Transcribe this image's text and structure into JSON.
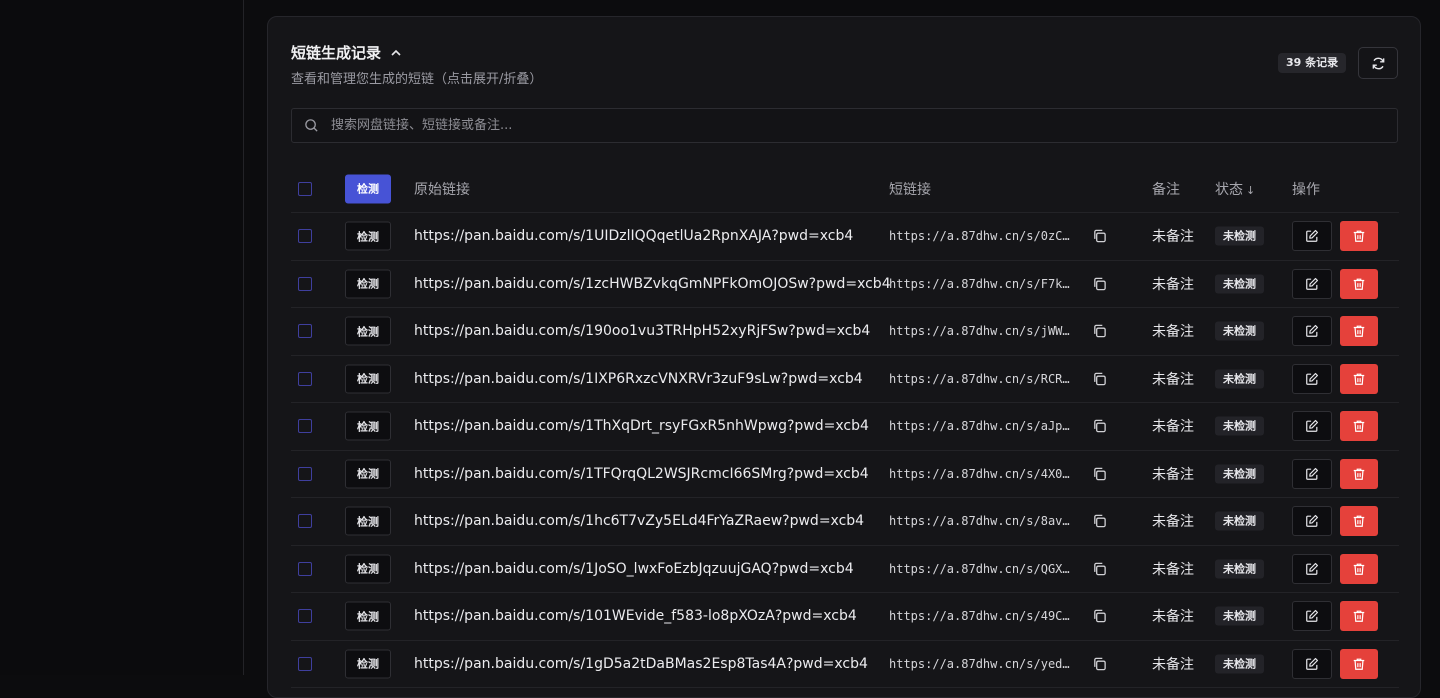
{
  "panel": {
    "title": "短链生成记录",
    "subtitle": "查看和管理您生成的短链（点击展开/折叠）",
    "count_badge": "39 条记录"
  },
  "search": {
    "placeholder": "搜索网盘链接、短链接或备注..."
  },
  "table": {
    "headers": {
      "detect": "检测",
      "original": "原始链接",
      "short": "短链接",
      "note": "备注",
      "status": "状态",
      "status_sort": "↓",
      "actions": "操作"
    },
    "rows": [
      {
        "detect": "检测",
        "original": "https://pan.baidu.com/s/1UIDzlIQQqetlUa2RpnXAJA?pwd=xcb4",
        "short": "https://a.87dhw.cn/s/0zC…",
        "note": "未备注",
        "status": "未检测"
      },
      {
        "detect": "检测",
        "original": "https://pan.baidu.com/s/1zcHWBZvkqGmNPFkOmOJOSw?pwd=xcb4",
        "short": "https://a.87dhw.cn/s/F7k…",
        "note": "未备注",
        "status": "未检测"
      },
      {
        "detect": "检测",
        "original": "https://pan.baidu.com/s/190oo1vu3TRHpH52xyRjFSw?pwd=xcb4",
        "short": "https://a.87dhw.cn/s/jWW…",
        "note": "未备注",
        "status": "未检测"
      },
      {
        "detect": "检测",
        "original": "https://pan.baidu.com/s/1IXP6RxzcVNXRVr3zuF9sLw?pwd=xcb4",
        "short": "https://a.87dhw.cn/s/RCR…",
        "note": "未备注",
        "status": "未检测"
      },
      {
        "detect": "检测",
        "original": "https://pan.baidu.com/s/1ThXqDrt_rsyFGxR5nhWpwg?pwd=xcb4",
        "short": "https://a.87dhw.cn/s/aJp…",
        "note": "未备注",
        "status": "未检测"
      },
      {
        "detect": "检测",
        "original": "https://pan.baidu.com/s/1TFQrqQL2WSJRcmcI66SMrg?pwd=xcb4",
        "short": "https://a.87dhw.cn/s/4X0…",
        "note": "未备注",
        "status": "未检测"
      },
      {
        "detect": "检测",
        "original": "https://pan.baidu.com/s/1hc6T7vZy5ELd4FrYaZRaew?pwd=xcb4",
        "short": "https://a.87dhw.cn/s/8av…",
        "note": "未备注",
        "status": "未检测"
      },
      {
        "detect": "检测",
        "original": "https://pan.baidu.com/s/1JoSO_lwxFoEzbJqzuujGAQ?pwd=xcb4",
        "short": "https://a.87dhw.cn/s/QGX…",
        "note": "未备注",
        "status": "未检测"
      },
      {
        "detect": "检测",
        "original": "https://pan.baidu.com/s/101WEvide_f583-lo8pXOzA?pwd=xcb4",
        "short": "https://a.87dhw.cn/s/49C…",
        "note": "未备注",
        "status": "未检测"
      },
      {
        "detect": "检测",
        "original": "https://pan.baidu.com/s/1gD5a2tDaBMas2Esp8Tas4A?pwd=xcb4",
        "short": "https://a.87dhw.cn/s/yed…",
        "note": "未备注",
        "status": "未检测"
      }
    ]
  },
  "icons": {
    "chevron": "chevron-up-icon",
    "refresh": "refresh-icon",
    "search": "search-icon",
    "copy": "copy-icon",
    "edit": "edit-icon",
    "delete": "trash-icon"
  },
  "colors": {
    "primary": "#4753d6",
    "danger": "#e5413b",
    "checkbox_border": "#3f3f9e"
  }
}
